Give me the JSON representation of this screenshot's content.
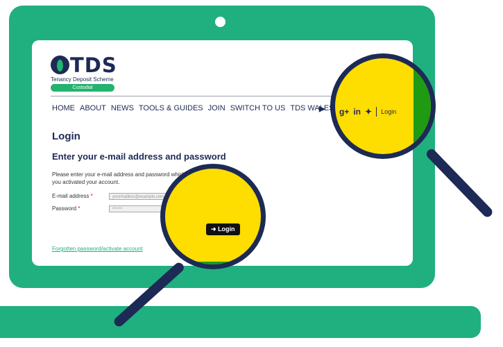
{
  "brand": {
    "name": "TDS",
    "subtitle": "Tenancy Deposit Scheme",
    "badge": "Custodial"
  },
  "nav": {
    "items": [
      "HOME",
      "ABOUT",
      "NEWS",
      "TOOLS & GUIDES",
      "JOIN",
      "SWITCH TO US",
      "TDS WALES"
    ]
  },
  "social": {
    "icons": [
      "youtube-icon",
      "google-plus-icon",
      "linkedin-icon",
      "twitter-icon"
    ],
    "login": "Login"
  },
  "login_page": {
    "title": "Login",
    "subtitle": "Enter your e-mail address and password",
    "intro_line1": "Please enter your e-mail address and password which you ch",
    "intro_line2": "you activated your account.",
    "email_label": "E-mail address",
    "email_placeholder": "yourmailbox@example.com",
    "password_label": "Password",
    "password_value": "******",
    "required_mark": "*",
    "login_button": "Login",
    "forgot_link": "Forgotten password/activate account"
  },
  "colors": {
    "laptop_green": "#20b07f",
    "navy": "#1d2a55",
    "lens_yellow": "#fedd00",
    "lens_green": "#1f9a13"
  }
}
